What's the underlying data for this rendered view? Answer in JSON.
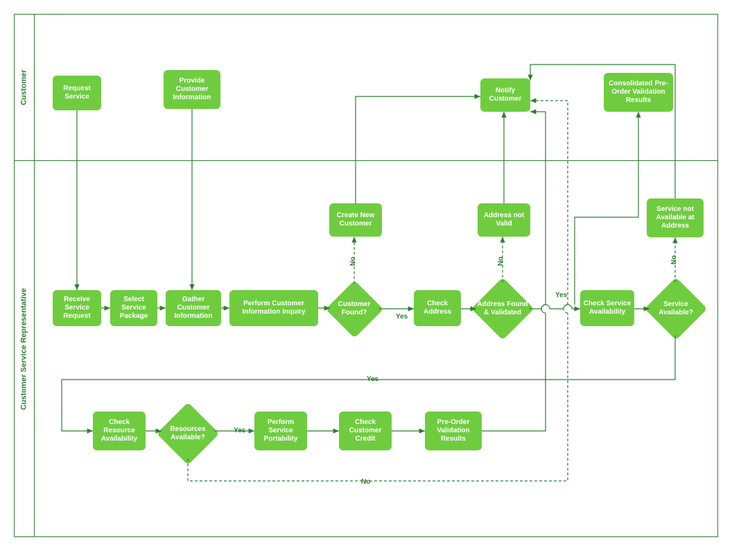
{
  "lanes": {
    "customer": "Customer",
    "csr": "Customer Service Representative"
  },
  "nodes": {
    "request_service": "Request Service",
    "provide_info": "Provide Customer Information",
    "notify_customer": "Notify Customer",
    "consolidated": "Consolidated Pre-Order Validation Results",
    "receive_request": "Receive Service Request",
    "select_package": "Select Service Package",
    "gather_info": "Gather Customer Information",
    "perform_inquiry": "Perform Customer Information Inquiry",
    "customer_found": "Customer Found?",
    "create_new": "Create New Customer",
    "check_address": "Check Address",
    "address_valid": "Address Found & Validated",
    "address_not_valid": "Address not Valid",
    "check_service": "Check Service Availability",
    "service_available": "Service Available?",
    "service_not_avail": "Service not Available at Address",
    "check_resource": "Check Resource Availability",
    "resources_avail": "Resources Available?",
    "perform_portability": "Perform Service Portability",
    "check_credit": "Check Customer Credit",
    "preorder_results": "Pre-Order Validation Results"
  },
  "labels": {
    "yes": "Yes",
    "no": "No"
  },
  "colors": {
    "fill": "#6fcc3f",
    "stroke": "#2e7d32"
  }
}
